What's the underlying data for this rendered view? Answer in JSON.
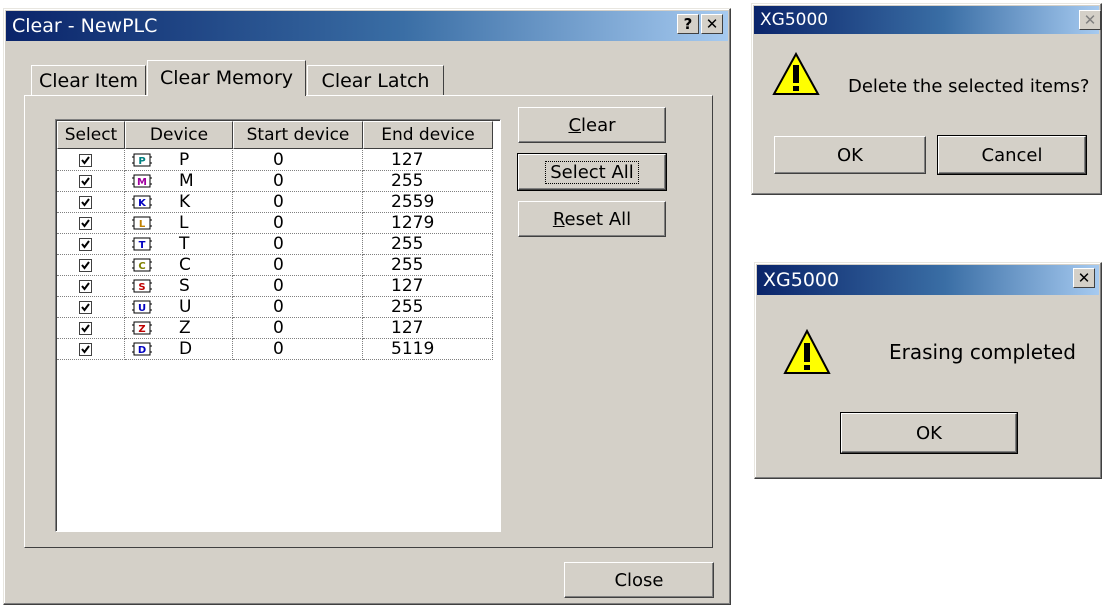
{
  "main_dialog": {
    "title": "Clear - NewPLC",
    "help_btn": "?",
    "close_x": "✕",
    "tabs": [
      "Clear Item",
      "Clear Memory",
      "Clear Latch"
    ],
    "columns": [
      "Select",
      "Device",
      "Start device",
      "End device"
    ],
    "rows": [
      {
        "checked": true,
        "device": "P",
        "start": "0",
        "end": "127",
        "icon_letter": "P",
        "icon_color": "#008080"
      },
      {
        "checked": true,
        "device": "M",
        "start": "0",
        "end": "255",
        "icon_letter": "M",
        "icon_color": "#a000a0"
      },
      {
        "checked": true,
        "device": "K",
        "start": "0",
        "end": "2559",
        "icon_letter": "K",
        "icon_color": "#0000c0"
      },
      {
        "checked": true,
        "device": "L",
        "start": "0",
        "end": "1279",
        "icon_letter": "L",
        "icon_color": "#c08000"
      },
      {
        "checked": true,
        "device": "T",
        "start": "0",
        "end": "255",
        "icon_letter": "T",
        "icon_color": "#0000c0"
      },
      {
        "checked": true,
        "device": "C",
        "start": "0",
        "end": "255",
        "icon_letter": "C",
        "icon_color": "#808000"
      },
      {
        "checked": true,
        "device": "S",
        "start": "0",
        "end": "127",
        "icon_letter": "S",
        "icon_color": "#c00000"
      },
      {
        "checked": true,
        "device": "U",
        "start": "0",
        "end": "255",
        "icon_letter": "U",
        "icon_color": "#0000c0"
      },
      {
        "checked": true,
        "device": "Z",
        "start": "0",
        "end": "127",
        "icon_letter": "Z",
        "icon_color": "#c00000"
      },
      {
        "checked": true,
        "device": "D",
        "start": "0",
        "end": "5119",
        "icon_letter": "D",
        "icon_color": "#0000c0"
      }
    ],
    "buttons": {
      "clear": "Clear",
      "select_all": "Select All",
      "reset_all": "Reset All",
      "close": "Close"
    }
  },
  "confirm_dialog": {
    "title": "XG5000",
    "close_x": "✕",
    "message": "Delete the selected items?",
    "ok": "OK",
    "cancel": "Cancel"
  },
  "done_dialog": {
    "title": "XG5000",
    "close_x": "✕",
    "message": "Erasing completed",
    "ok": "OK"
  },
  "colors": {
    "title_start": "#0a246a",
    "title_end": "#a6caf0",
    "face": "#d4d0c8",
    "warning": "#ffff00"
  }
}
